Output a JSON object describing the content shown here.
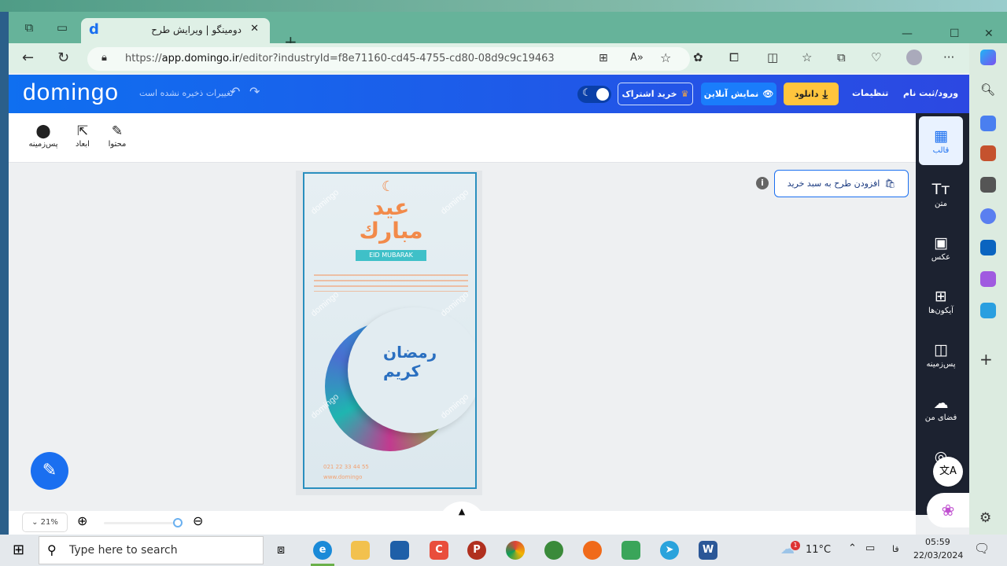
{
  "browser": {
    "tab_title": "دومینگو | ویرایش طرح",
    "url_prefix": "https://",
    "url_host": "app.domingo.ir",
    "url_path": "/editor?industryId=f8e71160-cd45-4755-cd80-08d9c9c19463"
  },
  "header": {
    "logo": "domingo",
    "unsaved": "تغییرات ذخیره نشده است",
    "subscribe": "خرید اشتراک",
    "online": "نمایش آنلاین",
    "download": "دانلود",
    "settings": "تنظیمات",
    "login": "ورود/ثبت نام"
  },
  "toolbar": {
    "items": [
      {
        "label": "پس‌زمینه",
        "icon": "circle-icon"
      },
      {
        "label": "ابعاد",
        "icon": "resize-icon"
      },
      {
        "label": "محتوا",
        "icon": "edit-icon"
      }
    ]
  },
  "sidebar": {
    "items": [
      {
        "label": "قالب"
      },
      {
        "label": "متن"
      },
      {
        "label": "عکس"
      },
      {
        "label": "آیکون‌ها"
      },
      {
        "label": "پس‌زمینه"
      },
      {
        "label": "فضای من"
      },
      {
        "label": ""
      }
    ]
  },
  "canvas": {
    "add_to_cart": "افزودن طرح به سبد خرید",
    "poster": {
      "title_ar": "عيد مبارك",
      "ribbon": "EID MUBARAK",
      "title2": "رمضان كريم",
      "phone": "021 22 33 44 55",
      "web": "www.domingo",
      "watermark": "domingo"
    }
  },
  "zoom": {
    "level": "21%",
    "slider_fraction": 1.0
  },
  "taskbar": {
    "search_placeholder": "Type here to search",
    "weather": "11°C",
    "weather_badge": "1",
    "lang": "فا",
    "time": "05:59",
    "date": "22/03/2024"
  },
  "colors": {
    "brand": "#1a6ff0",
    "download": "#ffc53d",
    "sidebar": "#1c2230"
  }
}
